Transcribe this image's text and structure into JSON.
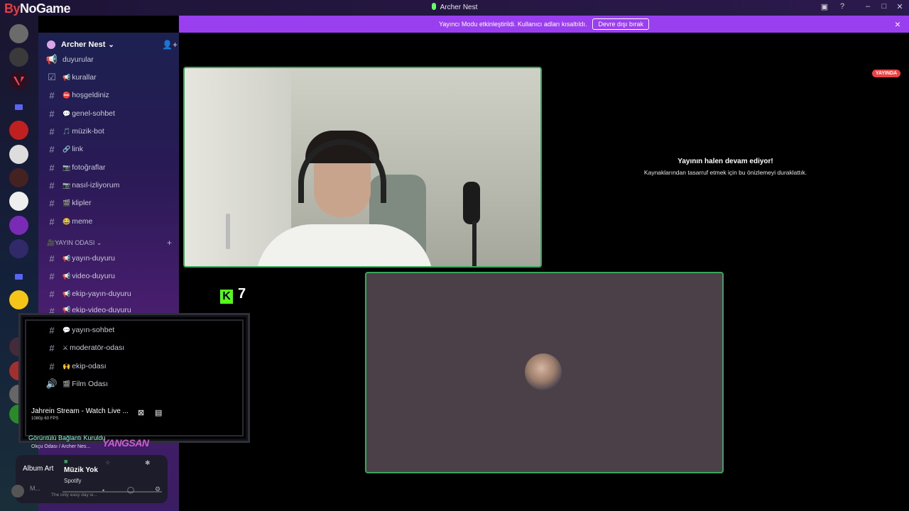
{
  "app": {
    "logo_prefix": "By",
    "logo_text": "NoGame",
    "window_title": "Archer Nest"
  },
  "banner": {
    "message": "Yayıncı Modu etkinleştirildi. Kullanıcı adları kısaltıldı.",
    "button": "Devre dışı bırak",
    "close": "×"
  },
  "server": {
    "name": "Archer Nest",
    "chevron": "⌄"
  },
  "channels": [
    {
      "icon": "megaphone-icon",
      "emoji": "",
      "label": "duyurular",
      "glyph": "📢"
    },
    {
      "icon": "rules-icon",
      "emoji": "📢",
      "label": "kurallar",
      "glyph": "☑"
    },
    {
      "icon": "hash-icon",
      "emoji": "⛔",
      "label": "hoşgeldiniz",
      "glyph": "#"
    },
    {
      "icon": "hash-icon",
      "emoji": "💬",
      "label": "genel-sohbet",
      "glyph": "#"
    },
    {
      "icon": "hash-icon",
      "emoji": "🎵",
      "label": "müzik-bot",
      "glyph": "#"
    },
    {
      "icon": "hash-icon",
      "emoji": "🔗",
      "label": "link",
      "glyph": "#"
    },
    {
      "icon": "hash-lock-icon",
      "emoji": "📷",
      "label": "fotoğraflar",
      "glyph": "#"
    },
    {
      "icon": "hash-lock-icon",
      "emoji": "📷",
      "label": "nasıl-izliyorum",
      "glyph": "#"
    },
    {
      "icon": "hash-lock-icon",
      "emoji": "🎬",
      "label": "klipler",
      "glyph": "#"
    },
    {
      "icon": "hash-lock-icon",
      "emoji": "😂",
      "label": "meme",
      "glyph": "#"
    }
  ],
  "category": {
    "label": "🎥YAYIN ODASI",
    "chevron": "⌄",
    "plus": "+"
  },
  "channels2": [
    {
      "emoji": "📢",
      "label": "yayın-duyuru"
    },
    {
      "emoji": "📢",
      "label": "video-duyuru"
    },
    {
      "emoji": "📢",
      "label": "ekip-yayın-duyuru"
    },
    {
      "emoji": "📢",
      "label": "ekip-video-duyuru"
    },
    {
      "emoji": "💬",
      "label": "yayın-sohbet"
    },
    {
      "emoji": "⚔",
      "label": "moderatör-odası"
    },
    {
      "emoji": "🙌",
      "label": "ekip-odası"
    },
    {
      "emoji": "🎬",
      "label": "Film Odası"
    }
  ],
  "activity": {
    "title": "Jahrein Stream - Watch Live ...",
    "quality": "1080p 60 FPS"
  },
  "voice": {
    "status": "Görüntülü Bağlantı Kuruldu",
    "location": "Okçu Odası / Archer Nes..."
  },
  "neon_text": "YANGSAN",
  "music": {
    "album_art": "Album Art",
    "title": "Müzik Yok",
    "source": "Spotify",
    "tagline": "The only easy day w...",
    "user": "M..."
  },
  "stream": {
    "kick_count": "7",
    "kick_logo": "K",
    "live_badge": "YAYINDA",
    "paused_title": "Yayının halen devam ediyor!",
    "paused_subtitle": "Kaynaklarından tasarruf etmek için bu önizlemeyi duraklattık."
  },
  "colors": {
    "banner": "#9a3ff0",
    "speaking_border": "#3ba55d",
    "live_red": "#ed4245",
    "kick_green": "#53fc18"
  }
}
